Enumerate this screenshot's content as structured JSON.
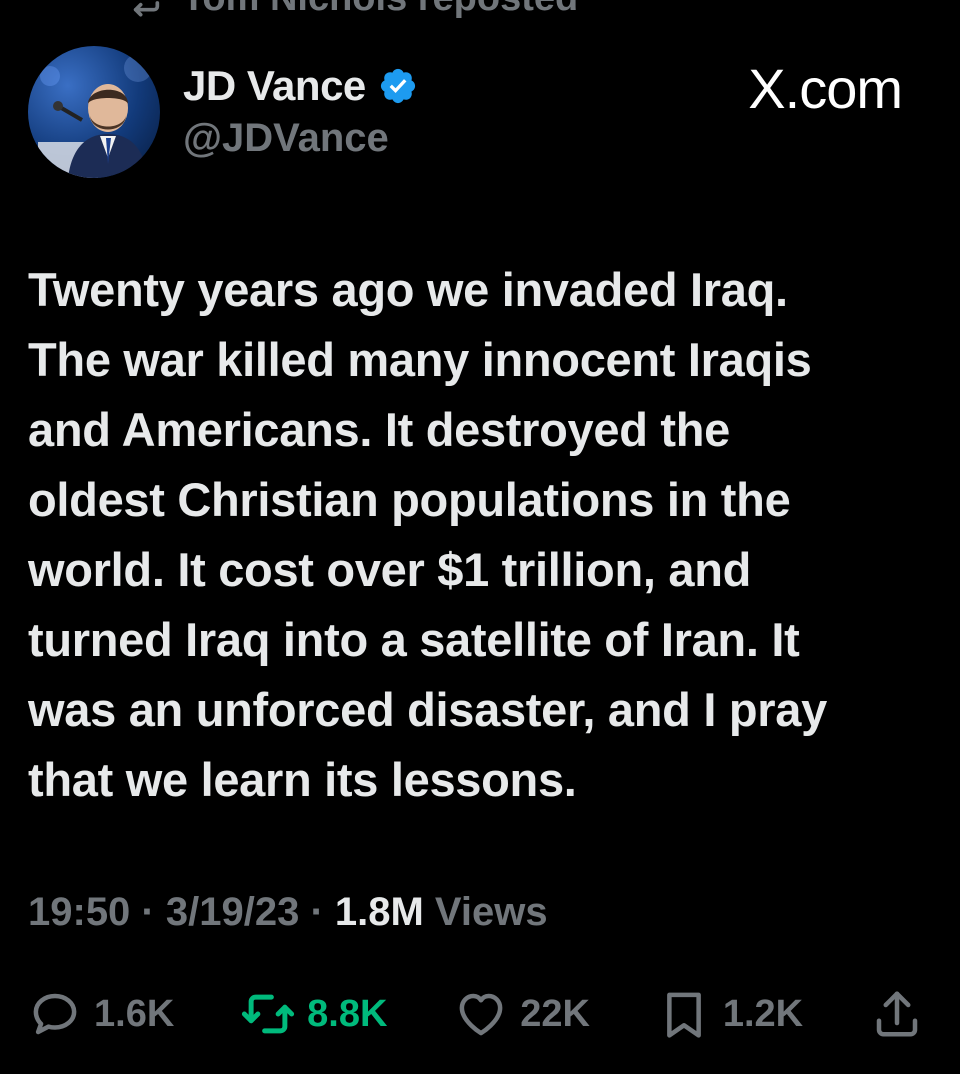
{
  "repost": {
    "label": "Tom Nichols reposted",
    "icon": "repost-icon"
  },
  "author": {
    "name": "JD Vance",
    "handle": "@JDVance",
    "verified_icon": "verified-badge-icon",
    "avatar_icon": "avatar"
  },
  "watermark": "X.com",
  "tweet": {
    "text": "Twenty years ago we invaded Iraq.\nThe war killed many innocent Iraqis\nand Americans. It destroyed the\noldest Christian populations in the\nworld. It cost over $1 trillion, and\nturned Iraq into a satellite of Iran. It\nwas an unforced disaster, and I pray\nthat we learn its lessons."
  },
  "meta": {
    "time": "19:50",
    "separator": " · ",
    "date": "3/19/23",
    "views_count": "1.8M",
    "views_label": " Views"
  },
  "actions": {
    "replies": "1.6K",
    "reposts": "8.8K",
    "likes": "22K",
    "bookmarks": "1.2K"
  },
  "colors": {
    "background": "#000000",
    "text": "#e7e9ea",
    "secondary": "#71767b",
    "retweet_green": "#00ba7c",
    "verified_blue": "#1d9bf0"
  }
}
